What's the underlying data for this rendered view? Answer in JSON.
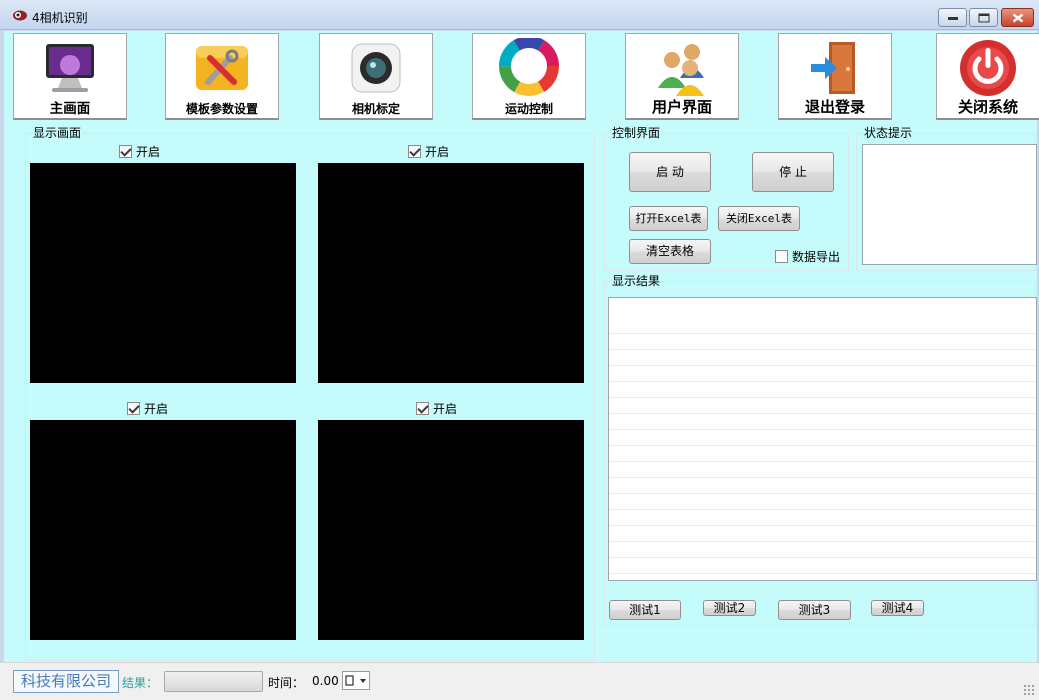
{
  "window": {
    "title": "4相机识别"
  },
  "toolbar": [
    {
      "label": "主画面",
      "icon": "monitor-icon"
    },
    {
      "label": "模板参数设置",
      "icon": "tools-icon"
    },
    {
      "label": "相机标定",
      "icon": "camera-icon"
    },
    {
      "label": "运动控制",
      "icon": "color-wheel-icon"
    },
    {
      "label": "用户界面",
      "icon": "users-icon"
    },
    {
      "label": "退出登录",
      "icon": "exit-door-icon"
    },
    {
      "label": "关闭系统",
      "icon": "power-icon"
    }
  ],
  "display": {
    "title": "显示画面",
    "cameras": [
      {
        "enable_label": "开启",
        "checked": true
      },
      {
        "enable_label": "开启",
        "checked": true
      },
      {
        "enable_label": "开启",
        "checked": true
      },
      {
        "enable_label": "开启",
        "checked": true
      }
    ]
  },
  "control": {
    "title": "控制界面",
    "start": "启  动",
    "stop": "停  止",
    "open_excel": "打开Excel表",
    "close_excel": "关闭Excel表",
    "clear_table": "清空表格",
    "export_label": "数据导出",
    "export_checked": false
  },
  "status": {
    "title": "状态提示"
  },
  "results": {
    "title": "显示结果",
    "tests": [
      "测试1",
      "测试2",
      "测试3",
      "测试4"
    ]
  },
  "statusbar": {
    "company": "科技有限公司",
    "result_label": "结果：",
    "time_label": "时间：",
    "time_value": "0.00"
  },
  "colors": {
    "client_bg": "#c5fbfb",
    "company_text": "#4a7ab9",
    "result_label": "#2aa198"
  }
}
